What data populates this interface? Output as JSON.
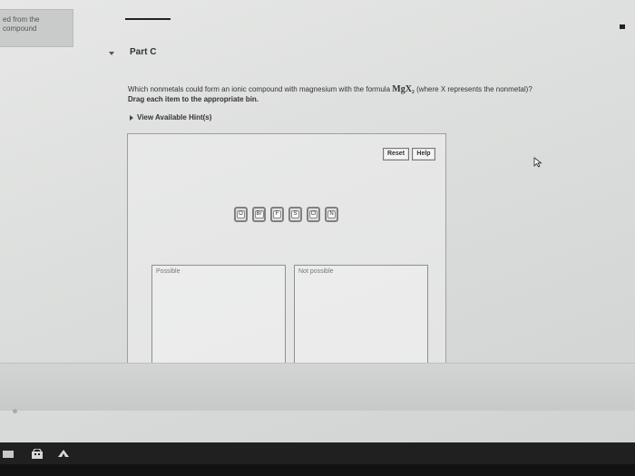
{
  "previous_part_snippet": [
    "ed from the",
    "compound"
  ],
  "part": {
    "title": "Part C"
  },
  "question": {
    "text_before": "Which nonmetals could form an ionic compound with magnesium with the formula ",
    "formula": "MgX₂",
    "text_after": " (where X represents the nonmetal)?"
  },
  "instruction": "Drag each item to the appropriate bin.",
  "hints_link": "View Available Hint(s)",
  "buttons": {
    "reset": "Reset",
    "help": "Help"
  },
  "tiles": [
    "O",
    "Br",
    "F",
    "S",
    "Cl",
    "N"
  ],
  "bins": {
    "possible": "Possible",
    "not_possible": "Not possible"
  },
  "icons": {
    "cursor": "mouse-pointer-icon",
    "taskbar": [
      "start-icon",
      "store-icon",
      "browser-icon"
    ]
  }
}
